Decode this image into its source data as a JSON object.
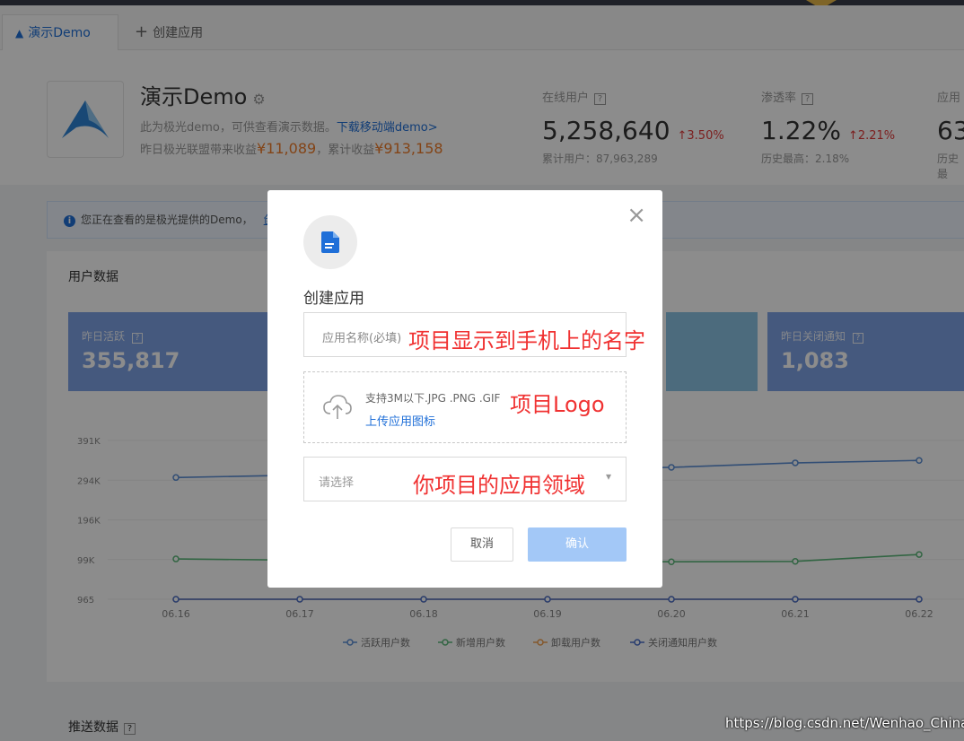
{
  "tabs": {
    "active_label": "演示Demo",
    "add_label": "创建应用"
  },
  "app": {
    "name": "演示Demo",
    "desc": "此为极光demo，可供查看演示数据。",
    "desc_link": "下载移动端demo>",
    "income_label": "昨日极光联盟带来收益",
    "income_value": "¥11,089",
    "total_label": "，累计收益",
    "total_value": "¥913,158"
  },
  "stats": [
    {
      "label": "在线用户",
      "value": "5,258,640",
      "change": "↑3.50%",
      "sub": "累计用户：87,963,289"
    },
    {
      "label": "渗透率",
      "value": "1.22%",
      "change": "↑2.21%",
      "sub": "历史最高：2.18%"
    },
    {
      "label": "应用",
      "value": "63",
      "change": "",
      "sub": "历史最"
    }
  ],
  "notice": {
    "text": "您正在查看的是极光提供的Demo，",
    "link": "创"
  },
  "panel": {
    "title": "用户数据",
    "cards": [
      {
        "label": "昨日活跃",
        "value": "355,817"
      },
      {
        "label": "昨日关闭通知",
        "value": "1,083"
      }
    ]
  },
  "chart_data": {
    "type": "line",
    "categories": [
      "06.16",
      "06.17",
      "06.18",
      "06.19",
      "06.20",
      "06.21",
      "06.22"
    ],
    "y_ticks": [
      "391K",
      "294K",
      "196K",
      "99K",
      "965"
    ],
    "ylim": [
      965,
      391000
    ],
    "series": [
      {
        "name": "活跃用户数",
        "color": "#5b8ed6",
        "values": [
          300000,
          306000,
          316000,
          320000,
          325000,
          336000,
          342000
        ]
      },
      {
        "name": "新增用户数",
        "color": "#5cb87a",
        "values": [
          100000,
          97000,
          95000,
          94000,
          93000,
          94000,
          111000
        ]
      },
      {
        "name": "卸载用户数",
        "color": "#f0a050",
        "values": [
          965,
          965,
          965,
          965,
          965,
          965,
          965
        ]
      },
      {
        "name": "关闭通知用户数",
        "color": "#4a6fcb",
        "values": [
          965,
          965,
          965,
          965,
          965,
          965,
          965
        ]
      }
    ],
    "legend": "bottom"
  },
  "section2_title": "推送数据",
  "modal": {
    "title": "创建应用",
    "close": "×",
    "name_placeholder": "应用名称(必填)",
    "name_annot": "项目显示到手机上的名字",
    "upload_hint": "支持3M以下.JPG .PNG .GIF",
    "upload_link": "上传应用图标",
    "upload_annot": "项目Logo",
    "select_placeholder": "请选择",
    "select_annot": "你项目的应用领域",
    "cancel": "取消",
    "ok": "确认"
  },
  "watermark": "https://blog.csdn.net/Wenhao_China",
  "colors": {
    "primary": "#1f6fd8",
    "annot": "#f03232",
    "money": "#ef7d2a"
  }
}
